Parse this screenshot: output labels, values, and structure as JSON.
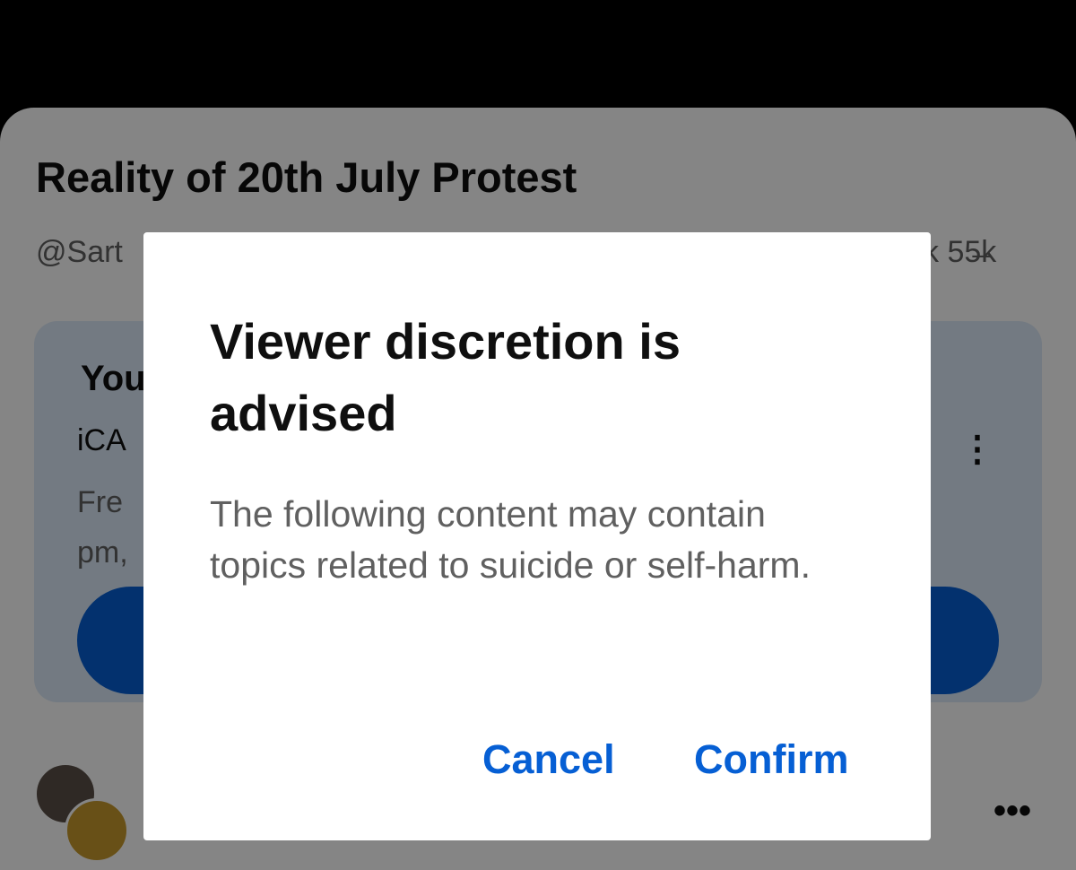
{
  "post": {
    "title": "Reality of 20th July Protest",
    "channel_partial": "@Sart",
    "stats_partial": "k 55̶k"
  },
  "ad": {
    "title_partial": "You",
    "channel_partial": "iCA",
    "desc_partial_line1": "Fre",
    "desc_partial_line2": "pm,",
    "more_icon": "⋮"
  },
  "feed": {
    "more_icon": "•••"
  },
  "dialog": {
    "title": "Viewer discretion is advised",
    "body": "The following content may contain topics related to suicide or self-harm.",
    "cancel_label": "Cancel",
    "confirm_label": "Confirm"
  },
  "colors": {
    "accent": "#065fd4",
    "scrim": "rgba(0,0,0,0.48)",
    "card_bg": "#ddeaf9"
  }
}
